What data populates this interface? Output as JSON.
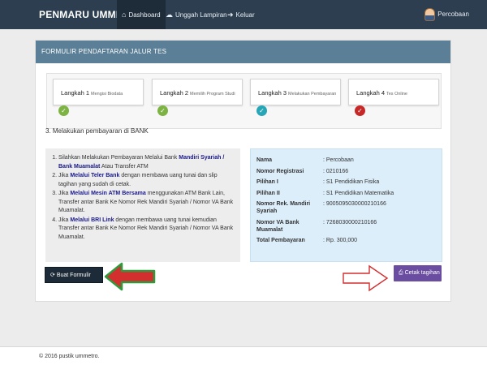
{
  "nav": {
    "brand": "PENMARU UMMETRO",
    "items": [
      {
        "label": "Dashboard",
        "icon": "home-icon"
      },
      {
        "label": "Unggah Lampiran",
        "icon": "upload-icon"
      },
      {
        "label": "Keluar",
        "icon": "logout-icon"
      }
    ],
    "user": "Percobaan"
  },
  "panel": {
    "title": "FORMULIR PENDAFTARAN JALUR TES",
    "steps": [
      {
        "label": "Langkah 1",
        "sub": "Mengisi Biodata",
        "color": "#7cb342"
      },
      {
        "label": "Langkah 2",
        "sub": "Memilih Program Studi",
        "color": "#7cb342"
      },
      {
        "label": "Langkah 3",
        "sub": "Melakukan Pembayaran",
        "color": "#26a6b7"
      },
      {
        "label": "Langkah 4",
        "sub": "Tes Online",
        "color": "#c62828"
      }
    ],
    "section_title": "3. Melakukan pembayaran di BANK"
  },
  "instructions": {
    "i1a": "Silahkan Melakukan Pembayaran Melalui Bank",
    "i1b": "Mandiri Syariah / Bank Muamalat",
    "i1c": "Atau Transfer ATM",
    "i2a": "Jika",
    "i2b": "Melalui Teler Bank",
    "i2c": "dengan membawa uang tunai dan slip tagihan yang sudah di cetak.",
    "i3a": "Jika",
    "i3b": "Melalui Mesin ATM Bersama",
    "i3c": "menggunakan ATM Bank Lain, Transfer antar Bank Ke Nomor Rek Mandiri Syariah / Nomor VA Bank Muamalat.",
    "i4a": "Jika",
    "i4b": "Melalui BRI Link",
    "i4c": "dengan membawa uang tunai kemudian Transfer antar Bank Ke Nomor Rek Mandiri Syariah / Nomor VA Bank Muamalat."
  },
  "info": [
    {
      "key": "Nama",
      "value": ": Percobaan"
    },
    {
      "key": "Nomor Registrasi",
      "value": ": 0210166"
    },
    {
      "key": "Pilihan I",
      "value": ": S1 Pendidikan Fisika"
    },
    {
      "key": "Pilihan II",
      "value": ": S1 Pendidikan Matematika"
    },
    {
      "key": "Nomor Rek. Mandiri Syariah",
      "value": ": 9005095030000210166"
    },
    {
      "key": "Nomor VA Bank Muamalat",
      "value": ": 7268030000210166"
    },
    {
      "key": "Total Pembayaran",
      "value": ": Rp. 300,000"
    }
  ],
  "buttons": {
    "new_form": "Buat Formulir Baru",
    "print_bill": "Cetak tagihan"
  },
  "footer": "© 2016 pustik ummetro."
}
